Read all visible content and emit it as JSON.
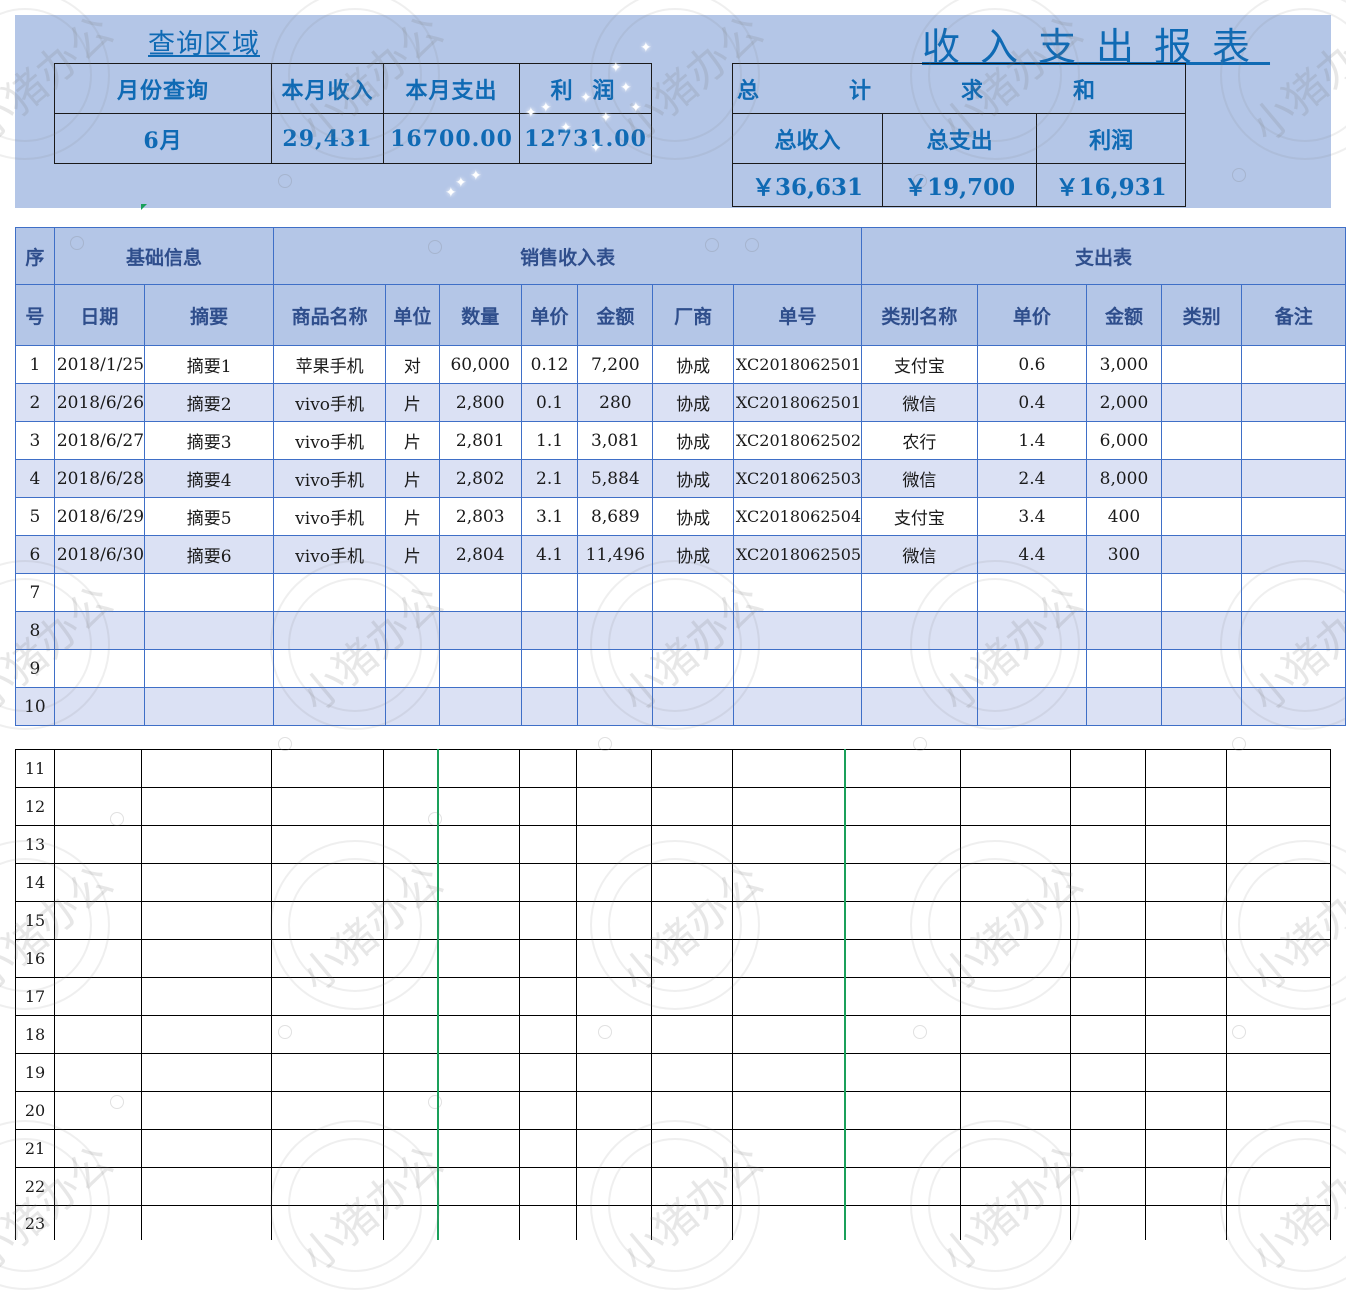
{
  "query_area": {
    "title": "查询区域",
    "headers": [
      "月份查询",
      "本月收入",
      "本月支出",
      "利 润"
    ],
    "values": [
      "6月",
      "29,431",
      "16700.00",
      "12731.00"
    ]
  },
  "report": {
    "title": "收入支出报表"
  },
  "totals": {
    "sum_heading": "总计求和",
    "labels": [
      "总收入",
      "总支出",
      "利润"
    ],
    "values": [
      "￥36,631",
      "￥19,700",
      "￥16,931"
    ]
  },
  "main_table": {
    "group_headers": {
      "seq_top": "序",
      "basic": "基础信息",
      "sales": "销售收入表",
      "expense": "支出表"
    },
    "column_headers": [
      "号",
      "日期",
      "摘要",
      "商品名称",
      "单位",
      "数量",
      "单价",
      "金额",
      "厂商",
      "单号",
      "类别名称",
      "单价",
      "金额",
      "类别",
      "备注"
    ],
    "rows": [
      [
        "1",
        "2018/1/25",
        "摘要1",
        "苹果手机",
        "对",
        "60,000",
        "0.12",
        "7,200",
        "协成",
        "XC2018062501",
        "支付宝",
        "0.6",
        "3,000",
        "",
        ""
      ],
      [
        "2",
        "2018/6/26",
        "摘要2",
        "vivo手机",
        "片",
        "2,800",
        "0.1",
        "280",
        "协成",
        "XC2018062501",
        "微信",
        "0.4",
        "2,000",
        "",
        ""
      ],
      [
        "3",
        "2018/6/27",
        "摘要3",
        "vivo手机",
        "片",
        "2,801",
        "1.1",
        "3,081",
        "协成",
        "XC2018062502",
        "农行",
        "1.4",
        "6,000",
        "",
        ""
      ],
      [
        "4",
        "2018/6/28",
        "摘要4",
        "vivo手机",
        "片",
        "2,802",
        "2.1",
        "5,884",
        "协成",
        "XC2018062503",
        "微信",
        "2.4",
        "8,000",
        "",
        ""
      ],
      [
        "5",
        "2018/6/29",
        "摘要5",
        "vivo手机",
        "片",
        "2,803",
        "3.1",
        "8,689",
        "协成",
        "XC2018062504",
        "支付宝",
        "3.4",
        "400",
        "",
        ""
      ],
      [
        "6",
        "2018/6/30",
        "摘要6",
        "vivo手机",
        "片",
        "2,804",
        "4.1",
        "11,496",
        "协成",
        "XC2018062505",
        "微信",
        "4.4",
        "300",
        "",
        ""
      ],
      [
        "7",
        "",
        "",
        "",
        "",
        "",
        "",
        "",
        "",
        "",
        "",
        "",
        "",
        "",
        ""
      ],
      [
        "8",
        "",
        "",
        "",
        "",
        "",
        "",
        "",
        "",
        "",
        "",
        "",
        "",
        "",
        ""
      ],
      [
        "9",
        "",
        "",
        "",
        "",
        "",
        "",
        "",
        "",
        "",
        "",
        "",
        "",
        "",
        ""
      ],
      [
        "10",
        "",
        "",
        "",
        "",
        "",
        "",
        "",
        "",
        "",
        "",
        "",
        "",
        "",
        ""
      ]
    ]
  },
  "lower_rows": [
    "11",
    "12",
    "13",
    "14",
    "15",
    "16",
    "17",
    "18",
    "19",
    "20",
    "21",
    "22",
    "23"
  ],
  "watermark": "小猪办公",
  "colors": {
    "band": "#b4c6e7",
    "alt_row": "#dbe1f4",
    "title_blue": "#0f6ab4",
    "grid_blue": "#3f6fc7",
    "green_line": "#1aa05a"
  }
}
